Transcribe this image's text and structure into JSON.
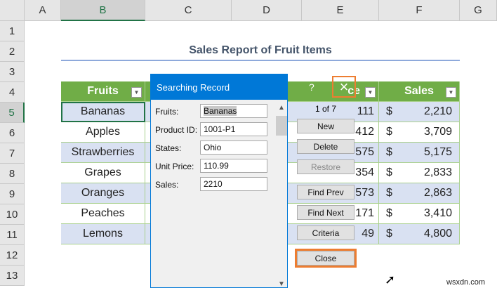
{
  "columns": [
    "A",
    "B",
    "C",
    "D",
    "E",
    "F",
    "G"
  ],
  "rows": [
    "1",
    "2",
    "3",
    "4",
    "5",
    "6",
    "7",
    "8",
    "9",
    "10",
    "11",
    "12",
    "13"
  ],
  "title": "Sales Report of Fruit Items",
  "table": {
    "headers": {
      "fruits": "Fruits",
      "price_partial": "ce",
      "sales": "Sales"
    },
    "fruits": [
      "Bananas",
      "Apples",
      "Strawberries",
      "Grapes",
      "Oranges",
      "Peaches",
      "Lemons"
    ],
    "price_partial": [
      "111",
      "412",
      "575",
      "354",
      "573",
      "171",
      "49"
    ],
    "currency": "$",
    "sales": [
      "2,210",
      "3,709",
      "5,175",
      "2,833",
      "2,863",
      "3,410",
      "4,800"
    ]
  },
  "dialog": {
    "title": "Searching Record",
    "help": "?",
    "close_icon": "×",
    "fields": [
      {
        "label": "Fruits:",
        "value": "Bananas"
      },
      {
        "label": "Product ID:",
        "value": "1001-P1"
      },
      {
        "label": "States:",
        "value": "Ohio"
      },
      {
        "label": "Unit Price:",
        "value": "110.99"
      },
      {
        "label": "Sales:",
        "value": "2210"
      }
    ],
    "record": "1 of 7",
    "buttons": {
      "new": "New",
      "delete": "Delete",
      "restore": "Restore",
      "find_prev": "Find Prev",
      "find_next": "Find Next",
      "criteria": "Criteria",
      "close": "Close"
    }
  },
  "watermark": "wsxdn.com",
  "colors": {
    "header_green": "#70ad47",
    "band": "#d9e1f2",
    "dialog_blue": "#0078d7",
    "highlight": "#ed7d31"
  }
}
